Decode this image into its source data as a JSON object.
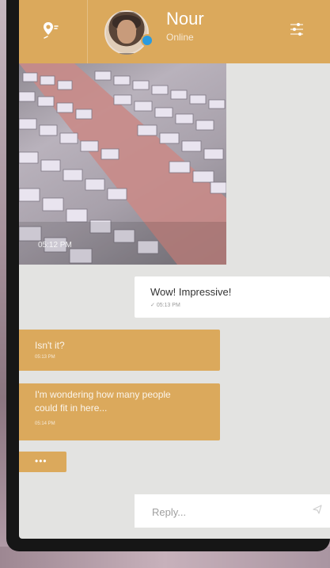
{
  "header": {
    "contact_name": "Nour",
    "contact_status": "Online",
    "location_icon": "location-pin-icon",
    "menu_icon": "sliders-menu-icon",
    "status_color": "#2a9be0"
  },
  "messages": [
    {
      "type": "image",
      "direction": "incoming",
      "time": "05:12 PM"
    },
    {
      "type": "text",
      "direction": "outgoing",
      "text": "Wow! Impressive!",
      "time": "05:13 PM"
    },
    {
      "type": "text",
      "direction": "incoming",
      "text": "Isn't it?",
      "time": "05:13 PM"
    },
    {
      "type": "text",
      "direction": "incoming",
      "text": "I'm wondering how many people could fit in here...",
      "time": "05:14 PM"
    },
    {
      "type": "typing",
      "direction": "incoming",
      "text": "•••"
    }
  ],
  "composer": {
    "placeholder": "Reply...",
    "send_icon": "send-icon"
  },
  "colors": {
    "accent": "#dba95c",
    "chat_background": "#e3e3e1",
    "outgoing_bubble": "#ffffff"
  }
}
